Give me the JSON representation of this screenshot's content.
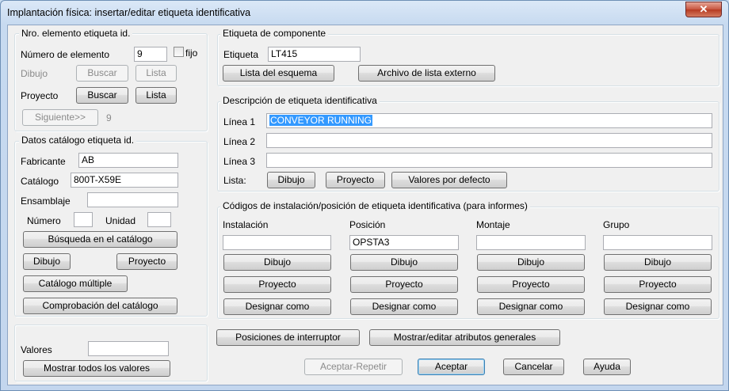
{
  "window": {
    "title": "Implantación física: insertar/editar etiqueta identificativa",
    "close_label": "✕"
  },
  "nro_elemento": {
    "title": "Nro. elemento etiqueta id.",
    "numero_label": "Número de elemento",
    "numero_value": "9",
    "fijo_label": "fijo",
    "fijo_checked": false,
    "dibujo_label": "Dibujo",
    "buscar_label": "Buscar",
    "lista_label": "Lista",
    "proyecto_label": "Proyecto",
    "siguiente_label": "Siguiente>>",
    "siguiente_value": "9"
  },
  "catalogo": {
    "title": "Datos catálogo etiqueta id.",
    "fabricante_label": "Fabricante",
    "fabricante_value": "AB",
    "catalogo_label": "Catálogo",
    "catalogo_value": "800T-X59E",
    "ensamblaje_label": "Ensamblaje",
    "ensamblaje_value": "",
    "numero_label": "Número",
    "numero_value": "",
    "unidad_label": "Unidad",
    "unidad_value": "",
    "busqueda_label": "Búsqueda en el catálogo",
    "dibujo_label": "Dibujo",
    "proyecto_label": "Proyecto",
    "multiple_label": "Catálogo múltiple",
    "comprobacion_label": "Comprobación del catálogo"
  },
  "valores": {
    "label": "Valores",
    "value": "",
    "mostrar_label": "Mostrar todos los valores"
  },
  "componente": {
    "title": "Etiqueta de componente",
    "etiqueta_label": "Etiqueta",
    "etiqueta_value": "LT415",
    "lista_esquema_label": "Lista del esquema",
    "archivo_label": "Archivo de lista externo"
  },
  "descripcion": {
    "title": "Descripción de etiqueta identificativa",
    "linea1_label": "Línea 1",
    "linea1_value": "CONVEYOR RUNNING",
    "linea2_label": "Línea 2",
    "linea2_value": "",
    "linea3_label": "Línea 3",
    "linea3_value": "",
    "lista_label": "Lista:",
    "dibujo_label": "Dibujo",
    "proyecto_label": "Proyecto",
    "valores_label": "Valores por defecto"
  },
  "codigos": {
    "title": "Códigos de instalación/posición de etiqueta identificativa (para informes)",
    "columns": [
      {
        "label": "Instalación",
        "value": "",
        "dibujo": "Dibujo",
        "proyecto": "Proyecto",
        "designar": "Designar como"
      },
      {
        "label": "Posición",
        "value": "OPSTA3",
        "dibujo": "Dibujo",
        "proyecto": "Proyecto",
        "designar": "Designar como"
      },
      {
        "label": "Montaje",
        "value": "",
        "dibujo": "Dibujo",
        "proyecto": "Proyecto",
        "designar": "Designar como"
      },
      {
        "label": "Grupo",
        "value": "",
        "dibujo": "Dibujo",
        "proyecto": "Proyecto",
        "designar": "Designar como"
      }
    ]
  },
  "footer": {
    "posiciones_label": "Posiciones de interruptor",
    "mostrar_editar_label": "Mostrar/editar atributos generales",
    "aceptar_repetir_label": "Aceptar-Repetir",
    "aceptar_label": "Aceptar",
    "cancelar_label": "Cancelar",
    "ayuda_label": "Ayuda"
  }
}
